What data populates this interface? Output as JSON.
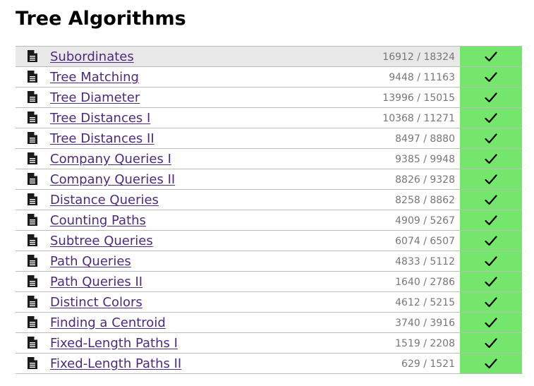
{
  "page": {
    "title": "Tree Algorithms"
  },
  "icons": {
    "task": "file-text-icon",
    "solved": "checkmark-icon"
  },
  "colors": {
    "solved_background": "#74e66c",
    "link": "#4e2a7c",
    "score": "#777777",
    "highlight_row": "#e8e8e8"
  },
  "tasks": [
    {
      "name": "Subordinates",
      "score": "16912 / 18324",
      "solved": true
    },
    {
      "name": "Tree Matching",
      "score": "9448 / 11163",
      "solved": true
    },
    {
      "name": "Tree Diameter",
      "score": "13996 / 15015",
      "solved": true
    },
    {
      "name": "Tree Distances I",
      "score": "10368 / 11271",
      "solved": true
    },
    {
      "name": "Tree Distances II",
      "score": "8497 / 8880",
      "solved": true
    },
    {
      "name": "Company Queries I",
      "score": "9385 / 9948",
      "solved": true
    },
    {
      "name": "Company Queries II",
      "score": "8826 / 9328",
      "solved": true
    },
    {
      "name": "Distance Queries",
      "score": "8258 / 8862",
      "solved": true
    },
    {
      "name": "Counting Paths",
      "score": "4909 / 5267",
      "solved": true
    },
    {
      "name": "Subtree Queries",
      "score": "6074 / 6507",
      "solved": true
    },
    {
      "name": "Path Queries",
      "score": "4833 / 5112",
      "solved": true
    },
    {
      "name": "Path Queries II",
      "score": "1640 / 2786",
      "solved": true
    },
    {
      "name": "Distinct Colors",
      "score": "4612 / 5215",
      "solved": true
    },
    {
      "name": "Finding a Centroid",
      "score": "3740 / 3916",
      "solved": true
    },
    {
      "name": "Fixed-Length Paths I",
      "score": "1519 / 2208",
      "solved": true
    },
    {
      "name": "Fixed-Length Paths II",
      "score": "629 / 1521",
      "solved": true
    }
  ]
}
